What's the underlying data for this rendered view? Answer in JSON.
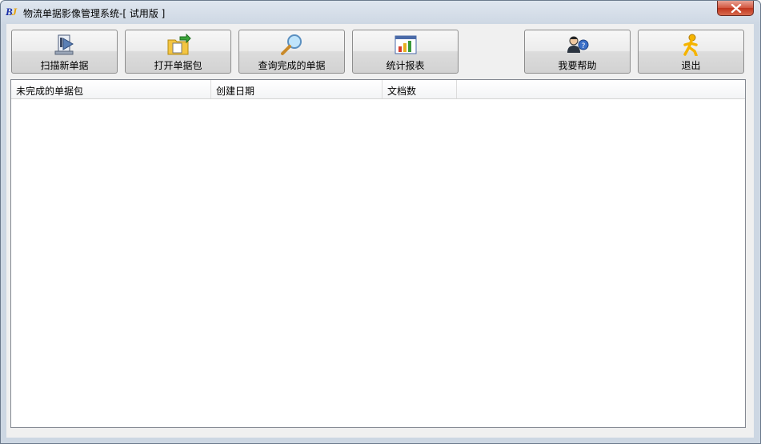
{
  "window": {
    "title": "物流单据影像管理系统-[ 试用版 ]",
    "logo_text": "BJ"
  },
  "toolbar": {
    "buttons": [
      {
        "label": "扫描新单据",
        "icon": "scan-document-icon"
      },
      {
        "label": "打开单据包",
        "icon": "open-folder-icon"
      },
      {
        "label": "查询完成的单据",
        "icon": "magnifier-icon"
      },
      {
        "label": "统计报表",
        "icon": "bar-chart-icon"
      },
      {
        "label": "我要帮助",
        "icon": "help-user-icon"
      },
      {
        "label": "退出",
        "icon": "exit-running-man-icon"
      }
    ]
  },
  "list": {
    "columns": [
      "未完成的单据包",
      "创建日期",
      "文档数"
    ],
    "rows": []
  },
  "colors": {
    "title_gradient_top": "#dfe6ef",
    "close_button_red": "#c0351d",
    "client_bg": "#f0f0f0"
  }
}
